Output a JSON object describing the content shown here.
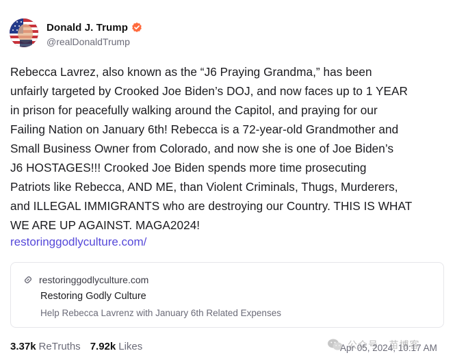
{
  "author": {
    "display_name": "Donald J. Trump",
    "handle": "@realDonaldTrump",
    "avatar_icon": "flag-portrait-avatar",
    "verified_icon": "verified-badge-icon",
    "verified_color": "#ff6a3d"
  },
  "post": {
    "lines": [
      "Rebecca Lavrez, also known as the “J6 Praying Grandma,” has been",
      "unfairly targeted by Crooked Joe Biden’s DOJ, and now faces up to 1 YEAR",
      "in prison for peacefully walking around the Capitol, and praying for our",
      "Failing Nation on January 6th! Rebecca is a 72-year-old Grandmother and",
      "Small Business Owner from Colorado, and now she is one of Joe Biden’s",
      "J6 HOSTAGES!!! Crooked Joe Biden spends more time prosecuting",
      "Patriots like Rebecca, AND ME, than Violent Criminals, Thugs, Murderers,",
      "and ILLEGAL IMMIGRANTS who are destroying our Country. THIS IS WHAT",
      "WE ARE UP AGAINST. MAGA2024!"
    ],
    "link_text": "restoringgodlyculture.com/",
    "link_color": "#5548d9"
  },
  "card": {
    "icon": "link-icon",
    "domain": "restoringgodlyculture.com",
    "title": "Restoring Godly Culture",
    "description": "Help Rebecca Lavrenz with January 6th Related Expenses"
  },
  "stats": {
    "retruths_count": "3.37k",
    "retruths_label": "ReTruths",
    "likes_count": "7.92k",
    "likes_label": "Likes"
  },
  "timestamp": "Apr 05, 2024, 10:17 AM",
  "watermark": {
    "icon": "wechat-icon",
    "text": "公众号 · 苗博客"
  }
}
